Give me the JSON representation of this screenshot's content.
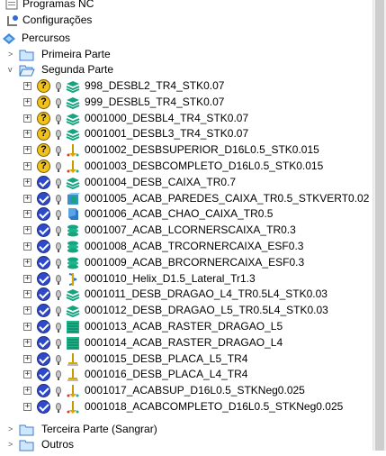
{
  "tree": {
    "top": [
      {
        "label": "Programas NC",
        "icon": "nc-programs-icon"
      },
      {
        "label": "Configurações",
        "icon": "setup-icon"
      },
      {
        "label": "Percursos",
        "icon": "toolpaths-icon"
      }
    ],
    "groups": [
      {
        "label": "Primeira Parte",
        "expanded": false
      },
      {
        "label": "Segunda Parte",
        "expanded": true
      },
      {
        "label": "Terceira Parte (Sangrar)",
        "expanded": false
      },
      {
        "label": "Outros",
        "expanded": false
      }
    ],
    "items": [
      {
        "label": "998_DESBL2_TR4_STK0.07",
        "status": "question",
        "type": "roughing-layers-icon"
      },
      {
        "label": "999_DESBL5_TR4_STK0.07",
        "status": "question",
        "type": "roughing-layers-icon"
      },
      {
        "label": "0001000_DESBL4_TR4_STK0.07",
        "status": "question",
        "type": "roughing-layers-icon"
      },
      {
        "label": "0001001_DESBL3_TR4_STK0.07",
        "status": "question",
        "type": "roughing-layers-icon"
      },
      {
        "label": "0001002_DESBSUPERIOR_D16L0.5_STK0.015",
        "status": "question",
        "type": "pencil-tool-icon"
      },
      {
        "label": "0001003_DESBCOMPLETO_D16L0.5_STK0.015",
        "status": "question",
        "type": "pencil-tool-icon"
      },
      {
        "label": "0001004_DESB_CAIXA_TR0.7",
        "status": "ok",
        "type": "roughing-layers-icon"
      },
      {
        "label": "0001005_ACAB_PAREDES_CAIXA_TR0.5_STKVERT0.02",
        "status": "ok",
        "type": "wall-finish-icon"
      },
      {
        "label": "0001006_ACAB_CHAO_CAIXA_TR0.5",
        "status": "ok",
        "type": "floor-finish-icon"
      },
      {
        "label": "0001007_ACAB_LCORNERSCAIXA_TR0.3",
        "status": "ok",
        "type": "corner-finish-icon"
      },
      {
        "label": "0001008_ACAB_TRCORNERCAIXA_ESF0.3",
        "status": "ok",
        "type": "corner-finish-icon"
      },
      {
        "label": "0001009_ACAB_BRCORNERCAIXA_ESF0.3",
        "status": "ok",
        "type": "corner-finish-icon"
      },
      {
        "label": "0001010_Helix_D1.5_Lateral_Tr1.3",
        "status": "ok",
        "type": "helix-icon"
      },
      {
        "label": "0001011_DESB_DRAGAO_L4_TR0.5L4_STK0.03",
        "status": "ok",
        "type": "roughing-layers-icon"
      },
      {
        "label": "0001012_DESB_DRAGAO_L5_TR0.5L4_STK0.03",
        "status": "ok",
        "type": "roughing-layers-icon"
      },
      {
        "label": "0001013_ACAB_RASTER_DRAGAO_L5",
        "status": "ok",
        "type": "raster-icon"
      },
      {
        "label": "0001014_ACAB_RASTER_DRAGAO_L4",
        "status": "ok",
        "type": "raster-icon"
      },
      {
        "label": "0001015_DESB_PLACA_L5_TR4",
        "status": "ok",
        "type": "flat-tool-icon"
      },
      {
        "label": "0001016_DESB_PLACA_L4_TR4",
        "status": "ok",
        "type": "flat-tool-icon"
      },
      {
        "label": "0001017_ACABSUP_D16L0.5_STKNeg0.025",
        "status": "ok",
        "type": "pencil-tool-icon"
      },
      {
        "label": "0001018_ACABCOMPLETO_D16L0.5_STKNeg0.025",
        "status": "ok",
        "type": "pencil-tool-icon"
      }
    ]
  },
  "colors": {
    "ok": "#2e49c9",
    "question": "#f2c21b",
    "layers": "#16a37f",
    "folder": "#5fa3dc"
  }
}
